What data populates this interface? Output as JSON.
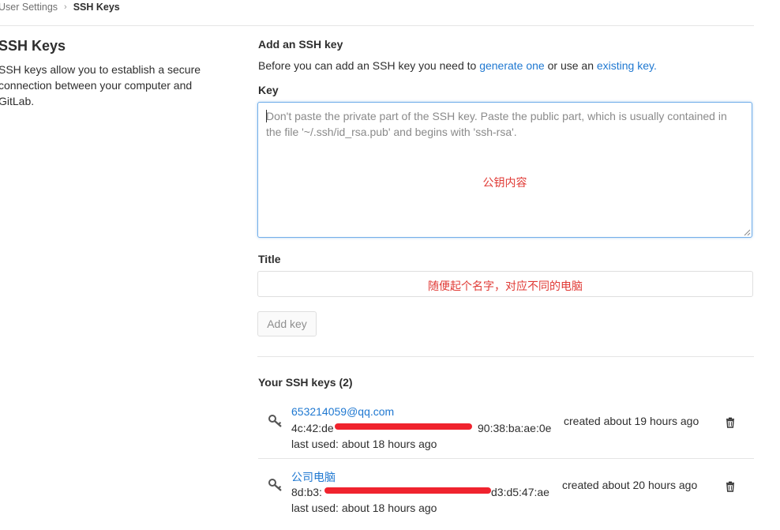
{
  "breadcrumb": {
    "parent": "User Settings",
    "separator": "›",
    "current": "SSH Keys"
  },
  "sidebar": {
    "title": "SSH Keys",
    "description": "SSH keys allow you to establish a secure connection between your computer and GitLab."
  },
  "add_key": {
    "heading": "Add an SSH key",
    "intro_before": "Before you can add an SSH key you need to ",
    "generate_link": "generate one",
    "intro_middle": " or use an ",
    "existing_link": "existing key.",
    "key_label": "Key",
    "key_placeholder": "Don't paste the private part of the SSH key. Paste the public part, which is usually contained in the file '~/.ssh/id_rsa.pub' and begins with 'ssh-rsa'.",
    "key_annotation": "公钥内容",
    "title_label": "Title",
    "title_annotation": "随便起个名字，对应不同的电脑",
    "add_button": "Add key"
  },
  "your_keys": {
    "heading": "Your SSH keys (2)",
    "items": [
      {
        "name": "653214059@qq.com",
        "fingerprint_start": "4c:42:de",
        "fingerprint_end": "90:38:ba:ae:0e",
        "last_used": "last used: about 18 hours ago",
        "created": "created about 19 hours ago",
        "icon": "key-icon"
      },
      {
        "name": "公司电脑",
        "fingerprint_start": "8d:b3:",
        "fingerprint_end": "d3:d5:47:ae",
        "last_used": "last used: about 18 hours ago",
        "created": "created about 20 hours ago",
        "icon": "key-icon"
      }
    ]
  },
  "colors": {
    "link": "#1f78d1",
    "annotation": "#e03a35",
    "redaction": "#f0232e",
    "focus_border": "#73afea"
  }
}
